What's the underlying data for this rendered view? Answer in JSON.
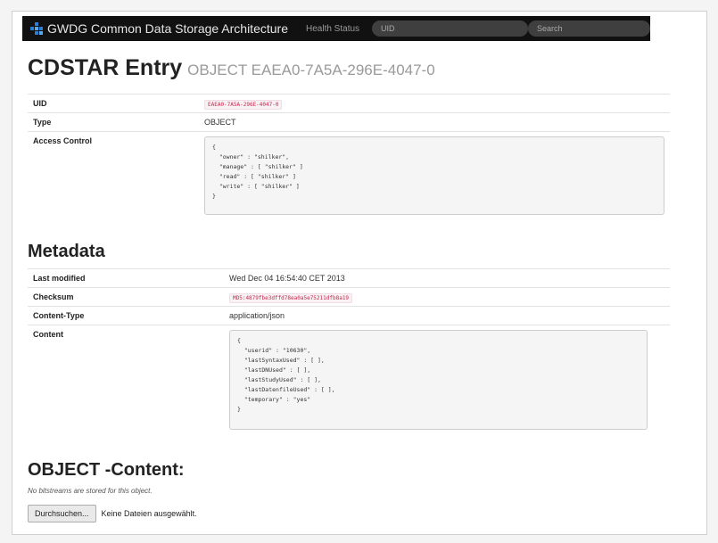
{
  "navbar": {
    "brand": "GWDG Common Data Storage Architecture",
    "health_link": "Health Status",
    "uid_placeholder": "UID",
    "search_placeholder": "Search"
  },
  "header": {
    "title": "CDSTAR Entry",
    "subtitle": "OBJECT EAEA0-7A5A-296E-4047-0"
  },
  "entry": {
    "uid_label": "UID",
    "uid_value": "EAEA0-7A5A-296E-4047-0",
    "type_label": "Type",
    "type_value": "OBJECT",
    "acl_label": "Access Control",
    "acl_value": "{\n  \"owner\" : \"shilker\",\n  \"manage\" : [ \"shilker\" ]\n  \"read\" : [ \"shilker\" ]\n  \"write\" : [ \"shilker\" ]\n}"
  },
  "metadata": {
    "title": "Metadata",
    "last_modified_label": "Last modified",
    "last_modified_value": "Wed Dec 04 16:54:40 CET 2013",
    "checksum_label": "Checksum",
    "checksum_value": "MD5:4879fbe3dffd78ea0a5e75211dfb8a19",
    "content_type_label": "Content-Type",
    "content_type_value": "application/json",
    "content_label": "Content",
    "content_value": "{\n  \"userid\" : \"10630\",\n  \"lastSyntaxUsed\" : [ ],\n  \"lastDNUsed\" : [ ],\n  \"lastStudyUsed\" : [ ],\n  \"lastDatenfileUsed\" : [ ],\n  \"temporary\" : \"yes\"\n}"
  },
  "content_section": {
    "title": "OBJECT -Content:",
    "note": "No bitstreams are stored for this object.",
    "upload_button": "Durchsuchen...",
    "upload_status": "Keine Dateien ausgewählt."
  },
  "colors": {
    "navbar_bg": "#111111",
    "code_pink": "#c7254e",
    "logo_blue": "#2a7fd4"
  }
}
